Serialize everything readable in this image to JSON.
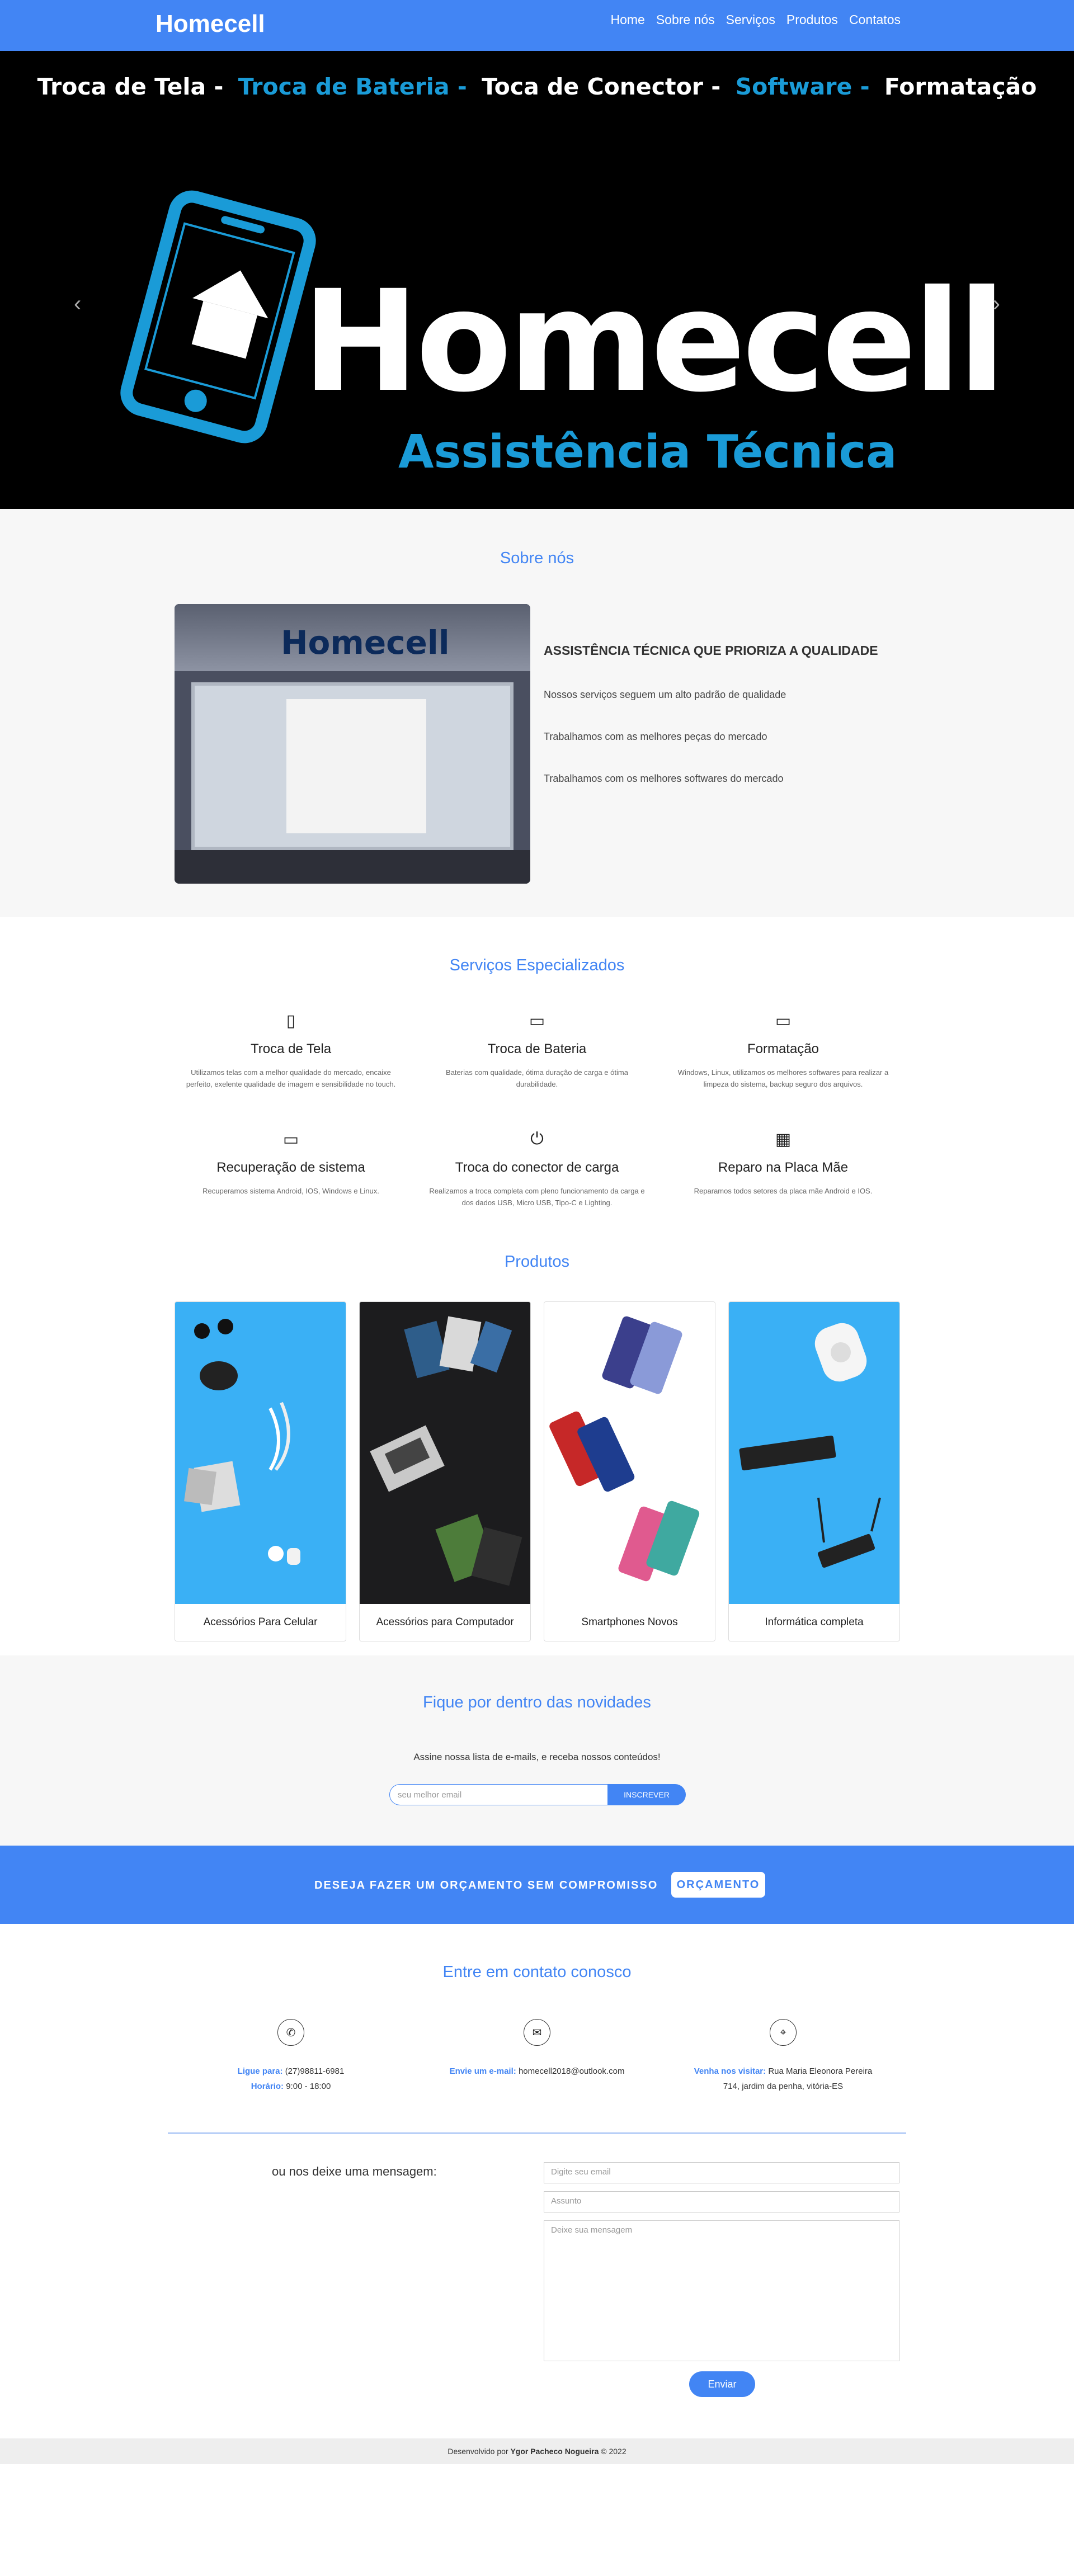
{
  "nav": {
    "brand": "Homecell",
    "items": [
      "Home",
      "Sobre nós",
      "Serviços",
      "Produtos",
      "Contatos"
    ]
  },
  "hero": {
    "services": [
      {
        "text": "Troca de Tela -",
        "color": "white"
      },
      {
        "text": "Troca de Bateria -",
        "color": "blue"
      },
      {
        "text": "Toca de Conector -",
        "color": "white"
      },
      {
        "text": "Software -",
        "color": "blue"
      },
      {
        "text": "Formatação",
        "color": "white"
      }
    ],
    "logo_text": "Homecell",
    "logo_subtitle": "Assistência Técnica",
    "prev": "‹",
    "next": "›"
  },
  "about": {
    "title": "Sobre nós",
    "photo_sign": "Homecell",
    "heading": "ASSISTÊNCIA TÉCNICA QUE PRIORIZA A QUALIDADE",
    "lines": [
      "Nossos serviços seguem um alto padrão de qualidade",
      "Trabalhamos com as melhores peças do mercado",
      "Trabalhamos com os melhores softwares do mercado"
    ]
  },
  "services": {
    "title": "Serviços Especializados",
    "items": [
      {
        "icon": "mobile-icon",
        "glyph": "▯",
        "title": "Troca de Tela",
        "desc": "Utilizamos telas com a melhor qualidade do mercado, encaixe perfeito, exelente qualidade de imagem e sensibilidade no touch."
      },
      {
        "icon": "battery-icon",
        "glyph": "▭",
        "title": "Troca de Bateria",
        "desc": "Baterias com qualidade, ótima duração de carga e ótima durabilidade."
      },
      {
        "icon": "desktop-icon",
        "glyph": "▭",
        "title": "Formatação",
        "desc": "Windows, Linux, utilizamos os melhores softwares para realizar a limpeza do sistema, backup seguro dos arquivos."
      },
      {
        "icon": "laptop-icon",
        "glyph": "▭",
        "title": "Recuperação de sistema",
        "desc": "Recuperamos sistema Android, IOS, Windows e Linux."
      },
      {
        "icon": "plug-icon",
        "glyph": "⏻",
        "title": "Troca do conector de carga",
        "desc": "Realizamos a troca completa com pleno funcionamento da carga e dos dados USB, Micro USB, Tipo-C e Lighting."
      },
      {
        "icon": "chip-icon",
        "glyph": "▦",
        "title": "Reparo na Placa Mãe",
        "desc": "Reparamos todos setores da placa mãe Android e IOS."
      }
    ]
  },
  "products": {
    "title": "Produtos",
    "items": [
      {
        "name": "Acessórios Para Celular",
        "bg": "#3ab0f5"
      },
      {
        "name": "Acessórios para Computador",
        "bg": "#1c1c1e"
      },
      {
        "name": "Smartphones Novos",
        "bg": "#ffffff"
      },
      {
        "name": "Informática completa",
        "bg": "#3ab0f5"
      }
    ]
  },
  "newsletter": {
    "title": "Fique por dentro das novidades",
    "lead": "Assine nossa lista de e-mails, e receba nossos conteúdos!",
    "placeholder": "seu melhor email",
    "button": "INSCREVER"
  },
  "cta": {
    "text": "DESEJA FAZER UM ORÇAMENTO SEM COMPROMISSO",
    "button": "ORÇAMENTO"
  },
  "contact": {
    "title": "Entre em contato conosco",
    "phone_label": "Ligue para:",
    "phone": "(27)98811-6981",
    "hours_label": "Horário:",
    "hours": "9:00 - 18:00",
    "email_label": "Envie um e-mail:",
    "email": "homecell2018@outlook.com",
    "address_label": "Venha nos visitar:",
    "address": "Rua Maria Eleonora Pereira 714, jardim da penha, vitória-ES",
    "message_label": "ou nos deixe uma mensagem:",
    "email_placeholder": "Digite seu email",
    "subject_placeholder": "Assunto",
    "message_placeholder": "Deixe sua mensagem",
    "send": "Enviar"
  },
  "footer": {
    "prefix": "Desenvolvido por",
    "author": "Ygor Pacheco Nogueira",
    "suffix": "© 2022"
  },
  "colors": {
    "primary": "#4285f4",
    "logo_blue": "#1a9bd7"
  }
}
